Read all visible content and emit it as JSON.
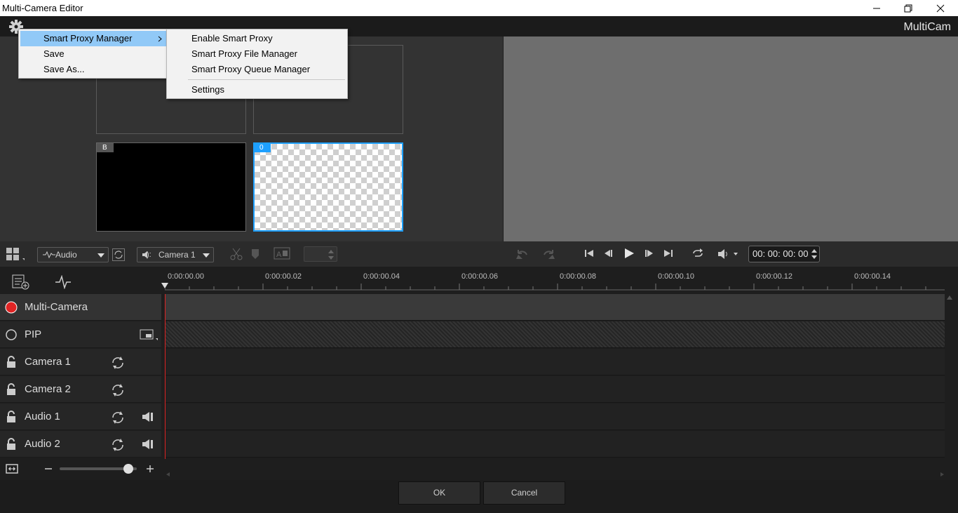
{
  "window": {
    "title": "Multi-Camera Editor"
  },
  "brand": "MultiCam",
  "context_menu": {
    "items": [
      {
        "label": "Smart Proxy Manager",
        "has_submenu": true,
        "highlighted": true
      },
      {
        "label": "Save"
      },
      {
        "label": "Save As..."
      }
    ],
    "submenu": [
      {
        "label": "Enable Smart Proxy"
      },
      {
        "label": "Smart Proxy File Manager"
      },
      {
        "label": "Smart Proxy Queue Manager"
      },
      {
        "label": "Settings"
      }
    ]
  },
  "grid_cells": [
    {
      "tag": "B",
      "style": "black"
    },
    {
      "tag": "0",
      "style": "transparent",
      "selected": true
    }
  ],
  "controls": {
    "audio_dropdown": "Audio",
    "camera_dropdown": "Camera 1",
    "camera_prefix": "):",
    "timecode": "00: 00: 00: 00"
  },
  "ruler": [
    "0:00:00.00",
    "0:00:00.02",
    "0:00:00.04",
    "0:00:00.06",
    "0:00:00.08",
    "0:00:00.10",
    "0:00:00.12",
    "0:00:00.14"
  ],
  "tracks": [
    {
      "name": "Multi-Camera",
      "type": "record"
    },
    {
      "name": "PIP",
      "type": "pip"
    },
    {
      "name": "Camera 1",
      "type": "camera"
    },
    {
      "name": "Camera 2",
      "type": "camera"
    },
    {
      "name": "Audio 1",
      "type": "audio"
    },
    {
      "name": "Audio 2",
      "type": "audio"
    }
  ],
  "zoom": {
    "level": 0.95
  },
  "buttons": {
    "ok": "OK",
    "cancel": "Cancel"
  },
  "colors": {
    "accent": "#1ea0ff",
    "record": "#e02424",
    "menu_highlight": "#91c9f7",
    "playhead": "#d22"
  }
}
